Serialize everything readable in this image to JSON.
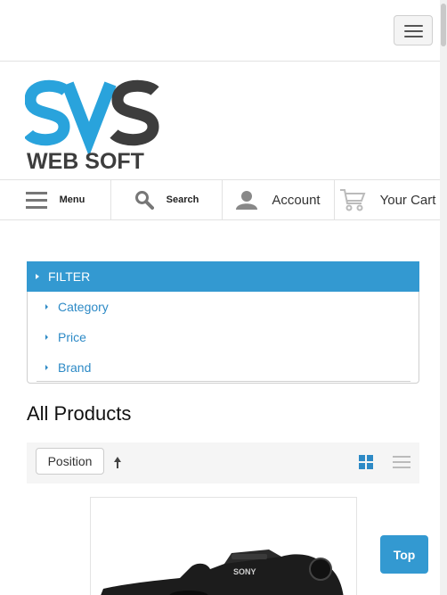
{
  "header": {
    "menu_toggle": "toggle-navigation"
  },
  "logo": {
    "letters": "SVS",
    "text": "WEB SOFT",
    "colors": {
      "blue": "#29a3dc",
      "dark": "#3d3d3d"
    }
  },
  "nav": {
    "menu": {
      "label": "Menu",
      "icon": "menu-icon"
    },
    "search": {
      "label": "Search",
      "icon": "search-icon"
    },
    "account": {
      "label": "Account",
      "icon": "user-icon"
    },
    "cart": {
      "label": "Your Cart",
      "icon": "cart-icon"
    }
  },
  "filter": {
    "title": "FILTER",
    "items": [
      {
        "label": "Category"
      },
      {
        "label": "Price"
      },
      {
        "label": "Brand"
      }
    ],
    "accent": "#3399d1"
  },
  "products": {
    "heading": "All Products",
    "sort_label": "Position",
    "sort_direction_icon": "arrow-up-icon",
    "view_modes": [
      "grid-icon",
      "list-icon"
    ],
    "first_product_image": "camera"
  },
  "scroll_top": {
    "label": "Top"
  }
}
